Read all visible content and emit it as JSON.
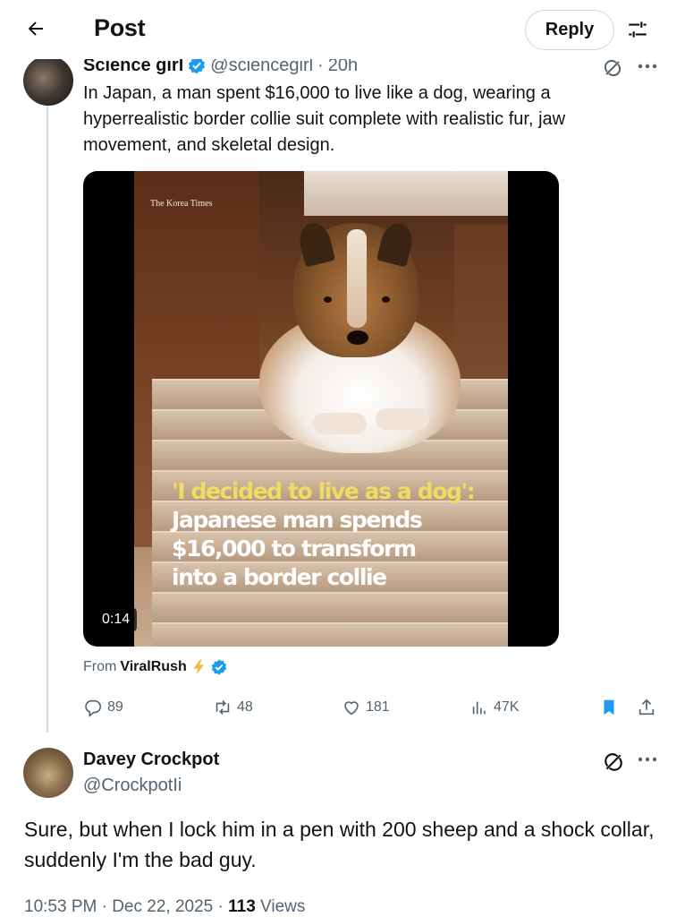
{
  "header": {
    "title": "Post",
    "reply_label": "Reply"
  },
  "post1": {
    "author_name": "Science girl",
    "handle": "@sciencegirl",
    "separator": "·",
    "age": "20h",
    "text": "In Japan, a man spent $16,000 to live like a dog, wearing a hyperrealistic border collie suit complete with realistic fur, jaw movement, and skeletal design.",
    "media": {
      "source_tag": "The Korea Times",
      "caption_line1": "'I decided to live as a dog':",
      "caption_line2": "Japanese man spends",
      "caption_line3": "$16,000 to transform",
      "caption_line4": "into a border collie",
      "duration": "0:14"
    },
    "from_prefix": "From",
    "from_name": "ViralRush",
    "actions": {
      "replies": "89",
      "reposts": "48",
      "likes": "181",
      "views": "47K"
    }
  },
  "post2": {
    "author_name": "Davey Crockpot",
    "handle": "@CrockpotIi",
    "text": "Sure, but when I lock him in a pen with 200 sheep and a shock collar, suddenly I'm the bad guy.",
    "time": "10:53 PM · Dec 22, 2025 · ",
    "views_count": "113",
    "views_label": " Views"
  },
  "colors": {
    "accent": "#1d9bf0",
    "text_primary": "#0f1419",
    "text_secondary": "#536471",
    "caption_yellow": "#f0dc63",
    "bolt": "#f5b93a"
  },
  "icons": [
    "back-arrow-icon",
    "settings-sliders-icon",
    "verified-badge-icon",
    "grok-icon",
    "more-icon",
    "bolt-icon",
    "reply-icon",
    "repost-icon",
    "like-icon",
    "views-icon",
    "bookmark-icon",
    "share-icon"
  ]
}
